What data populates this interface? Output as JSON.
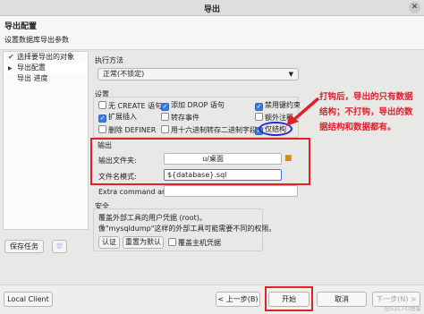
{
  "window": {
    "title": "导出",
    "close_glyph": "✕"
  },
  "header": {
    "title": "导出配置",
    "subtitle": "设置数据库导出参数"
  },
  "sidebar": {
    "items": [
      {
        "label": "选择要导出的对象",
        "mark": "✔"
      },
      {
        "label": "导出配置",
        "mark": "▶"
      },
      {
        "label": "导出 进度",
        "mark": ""
      }
    ]
  },
  "save_task_label": "保存任务",
  "small_button_glyph": "⛆",
  "execution": {
    "group_label": "执行方法",
    "selected": "正常(不锁定)"
  },
  "settings": {
    "group_label": "设置",
    "checkboxes": [
      {
        "label": "无 CREATE 语句",
        "checked": false
      },
      {
        "label": "添加 DROP 语句",
        "checked": true
      },
      {
        "label": "禁用键约束",
        "checked": true
      },
      {
        "label": "扩展插入",
        "checked": true
      },
      {
        "label": "转存事件",
        "checked": false
      },
      {
        "label": "额外注释",
        "checked": false
      },
      {
        "label": "删除 DEFINER",
        "checked": false
      },
      {
        "label": "用十六进制转存二进制字段",
        "checked": false
      },
      {
        "label": "仅结构",
        "checked": true
      }
    ]
  },
  "output": {
    "group_label": "输出",
    "folder_label": "输出文件夹:",
    "folder_value": "u/桌面",
    "filename_label": "文件名模式:",
    "filename_value": "${database}.sql",
    "extra_label": "Extra command args:",
    "extra_value": ""
  },
  "security": {
    "group_label": "安全",
    "line1": "覆盖外部工具的用户凭据 (root)。",
    "line2": "像\"mysqldump\"这样的外部工具可能需要不同的权限。",
    "auth_label": "认证",
    "reset_label": "重置为默认",
    "override_label": "覆盖主机凭据"
  },
  "annotation": {
    "text": "打钩后，导出的只有数据结构；不打钩，导出的数据结构和数据都有。",
    "color": "#e0202a",
    "ellipse_color": "#1f2fd0"
  },
  "footer": {
    "local_client_label": "Local Client ...",
    "prev_label": "< 上一步(B)",
    "start_label": "开始",
    "cancel_label": "取消",
    "next_label": "下一步(N) >"
  },
  "watermark": "@51CTO博客"
}
